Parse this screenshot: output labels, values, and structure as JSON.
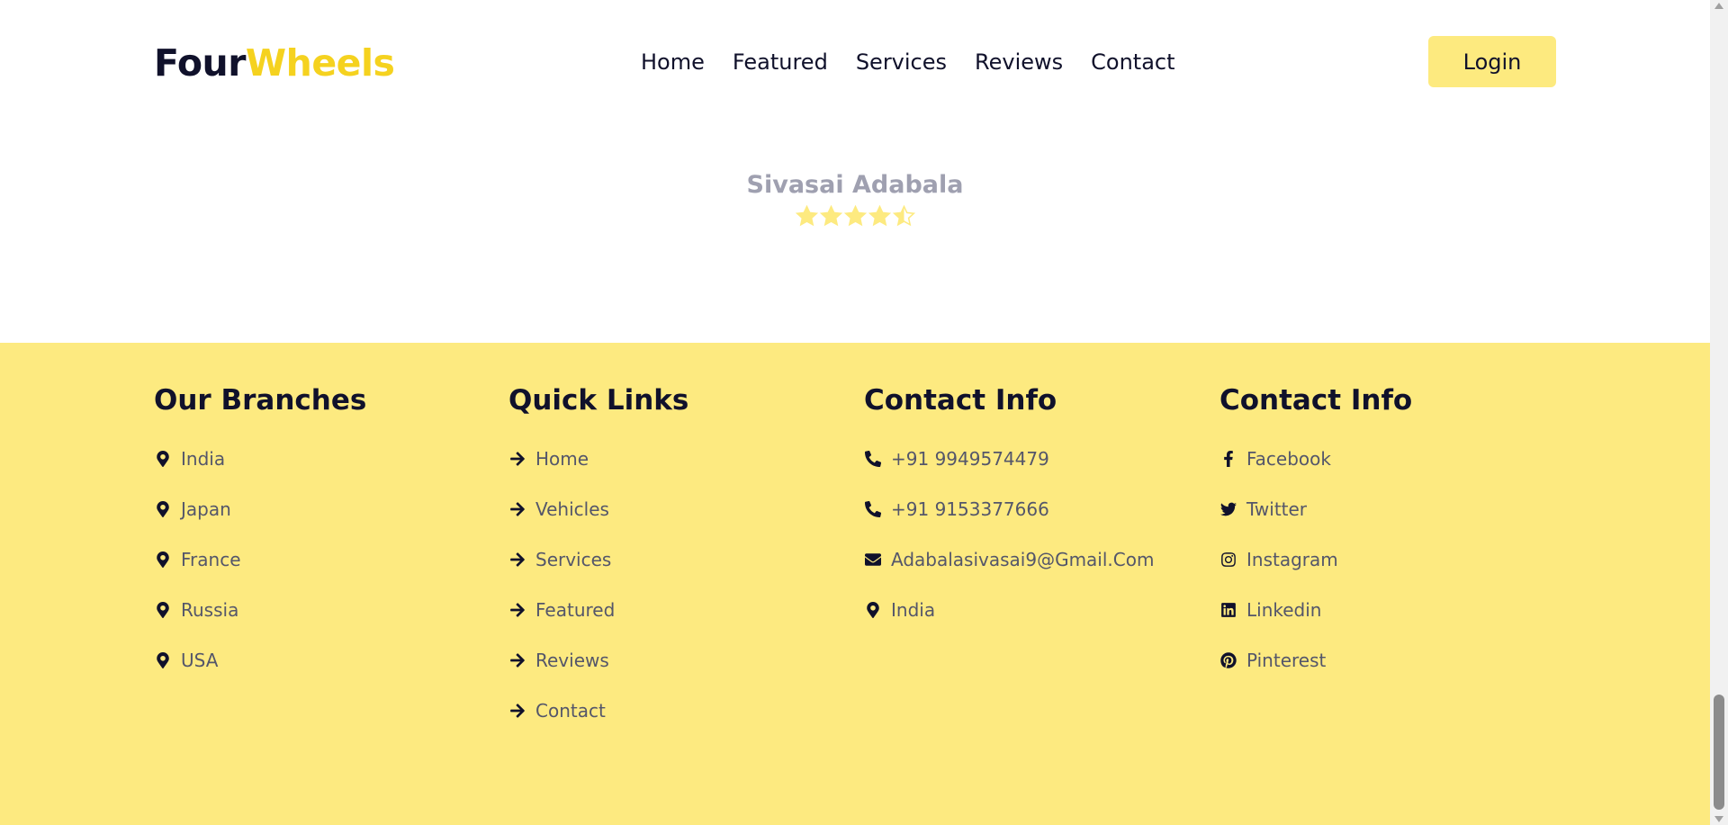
{
  "header": {
    "logo_part1": "Four",
    "logo_part2": "Wheels",
    "nav": [
      "Home",
      "Featured",
      "Services",
      "Reviews",
      "Contact"
    ],
    "login_label": "Login"
  },
  "review": {
    "name": "Sivasai Adabala",
    "rating": 4.5,
    "rating_max": 5
  },
  "footer": {
    "branches": {
      "title": "Our Branches",
      "items": [
        {
          "icon": "map-marker-icon",
          "label": "India"
        },
        {
          "icon": "map-marker-icon",
          "label": "Japan"
        },
        {
          "icon": "map-marker-icon",
          "label": "France"
        },
        {
          "icon": "map-marker-icon",
          "label": "Russia"
        },
        {
          "icon": "map-marker-icon",
          "label": "USA"
        }
      ]
    },
    "quick_links": {
      "title": "Quick Links",
      "items": [
        {
          "icon": "arrow-right-icon",
          "label": "Home"
        },
        {
          "icon": "arrow-right-icon",
          "label": "Vehicles"
        },
        {
          "icon": "arrow-right-icon",
          "label": "Services"
        },
        {
          "icon": "arrow-right-icon",
          "label": "Featured"
        },
        {
          "icon": "arrow-right-icon",
          "label": "Reviews"
        },
        {
          "icon": "arrow-right-icon",
          "label": "Contact"
        }
      ]
    },
    "contact_info": {
      "title": "Contact Info",
      "items": [
        {
          "icon": "phone-icon",
          "label": "+91 9949574479"
        },
        {
          "icon": "phone-icon",
          "label": "+91 9153377666"
        },
        {
          "icon": "envelope-icon",
          "label": "Adabalasivasai9@Gmail.Com"
        },
        {
          "icon": "map-marker-icon",
          "label": "India"
        }
      ]
    },
    "social": {
      "title": "Contact Info",
      "items": [
        {
          "icon": "facebook-icon",
          "label": "Facebook"
        },
        {
          "icon": "twitter-icon",
          "label": "Twitter"
        },
        {
          "icon": "instagram-icon",
          "label": "Instagram"
        },
        {
          "icon": "linkedin-icon",
          "label": "Linkedin"
        },
        {
          "icon": "pinterest-icon",
          "label": "Pinterest"
        }
      ]
    }
  },
  "colors": {
    "brand_dark": "#10112b",
    "brand_yellow": "#f5d21f",
    "footer_bg": "#fdea80",
    "button_bg": "#fdea7f",
    "star_color": "#fdea80"
  }
}
